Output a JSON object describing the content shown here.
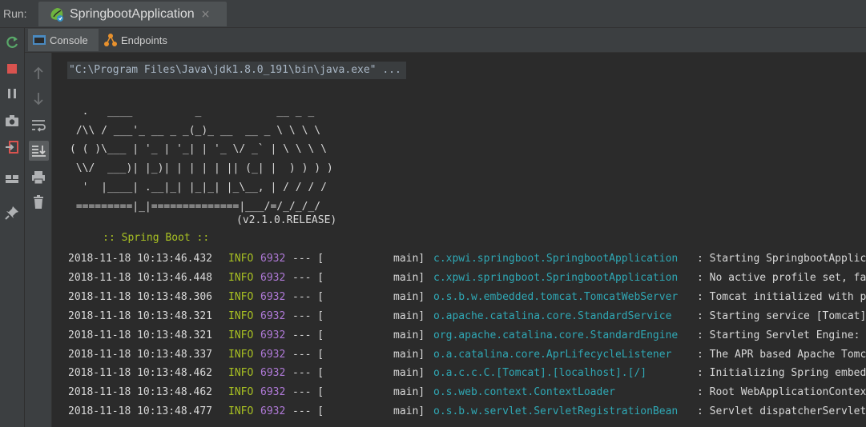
{
  "runbar": {
    "label": "Run:",
    "tab_title": "SpringbootApplication",
    "close": "×"
  },
  "subtabs": [
    {
      "label": "Console",
      "icon": "console-icon",
      "active": true
    },
    {
      "label": "Endpoints",
      "icon": "endpoints-icon",
      "active": false
    }
  ],
  "left_toolbar": [
    "rerun-icon",
    "stop-icon",
    "pause-icon",
    "camera-icon",
    "exit-icon",
    "layout-icon",
    "pin-icon"
  ],
  "inner_toolbar": [
    "arrow-up-icon",
    "arrow-down-icon",
    "soft-wrap-icon",
    "scroll-to-end-icon",
    "print-icon",
    "trash-icon"
  ],
  "console": {
    "command": "\"C:\\Program Files\\Java\\jdk1.8.0_191\\bin\\java.exe\" ...",
    "banner": "  .   ____          _            __ _ _\n /\\\\ / ___'_ __ _ _(_)_ __  __ _ \\ \\ \\ \\\n( ( )\\___ | '_ | '_| | '_ \\/ _` | \\ \\ \\ \\\n \\\\/  ___)| |_)| | | | | || (_| |  ) ) ) )\n  '  |____| .__|_| |_|_| |_\\__, | / / / /\n =========|_|==============|___/=/_/_/_/",
    "spring_label": " :: Spring Boot ::",
    "spring_version": "(v2.1.0.RELEASE)",
    "logs": [
      {
        "ts": "2018-11-18 10:13:46.432",
        "level": "INFO",
        "pid": "6932",
        "sep": "--- [",
        "thread": "main]",
        "logger": "c.xpwi.springboot.SpringbootApplication",
        "msg": ": Starting SpringbootApplication"
      },
      {
        "ts": "2018-11-18 10:13:46.448",
        "level": "INFO",
        "pid": "6932",
        "sep": "--- [",
        "thread": "main]",
        "logger": "c.xpwi.springboot.SpringbootApplication",
        "msg": ": No active profile set, fall"
      },
      {
        "ts": "2018-11-18 10:13:48.306",
        "level": "INFO",
        "pid": "6932",
        "sep": "--- [",
        "thread": "main]",
        "logger": "o.s.b.w.embedded.tomcat.TomcatWebServer",
        "msg": ": Tomcat initialized with port"
      },
      {
        "ts": "2018-11-18 10:13:48.321",
        "level": "INFO",
        "pid": "6932",
        "sep": "--- [",
        "thread": "main]",
        "logger": "o.apache.catalina.core.StandardService",
        "msg": ": Starting service [Tomcat]"
      },
      {
        "ts": "2018-11-18 10:13:48.321",
        "level": "INFO",
        "pid": "6932",
        "sep": "--- [",
        "thread": "main]",
        "logger": "org.apache.catalina.core.StandardEngine",
        "msg": ": Starting Servlet Engine: Apa"
      },
      {
        "ts": "2018-11-18 10:13:48.337",
        "level": "INFO",
        "pid": "6932",
        "sep": "--- [",
        "thread": "main]",
        "logger": "o.a.catalina.core.AprLifecycleListener",
        "msg": ": The APR based Apache Tomcat"
      },
      {
        "ts": "2018-11-18 10:13:48.462",
        "level": "INFO",
        "pid": "6932",
        "sep": "--- [",
        "thread": "main]",
        "logger": "o.a.c.c.C.[Tomcat].[localhost].[/]",
        "msg": ": Initializing Spring embedded"
      },
      {
        "ts": "2018-11-18 10:13:48.462",
        "level": "INFO",
        "pid": "6932",
        "sep": "--- [",
        "thread": "main]",
        "logger": "o.s.web.context.ContextLoader",
        "msg": ": Root WebApplicationContext:"
      },
      {
        "ts": "2018-11-18 10:13:48.477",
        "level": "INFO",
        "pid": "6932",
        "sep": "--- [",
        "thread": "main]",
        "logger": "o.s.b.w.servlet.ServletRegistrationBean",
        "msg": ": Servlet dispatcherServlet m"
      }
    ]
  },
  "colors": {
    "bg": "#2b2b2b",
    "panel": "#3c3f41",
    "info": "#a8c023",
    "pid": "#b07ad8",
    "logger": "#2fa8b5"
  }
}
